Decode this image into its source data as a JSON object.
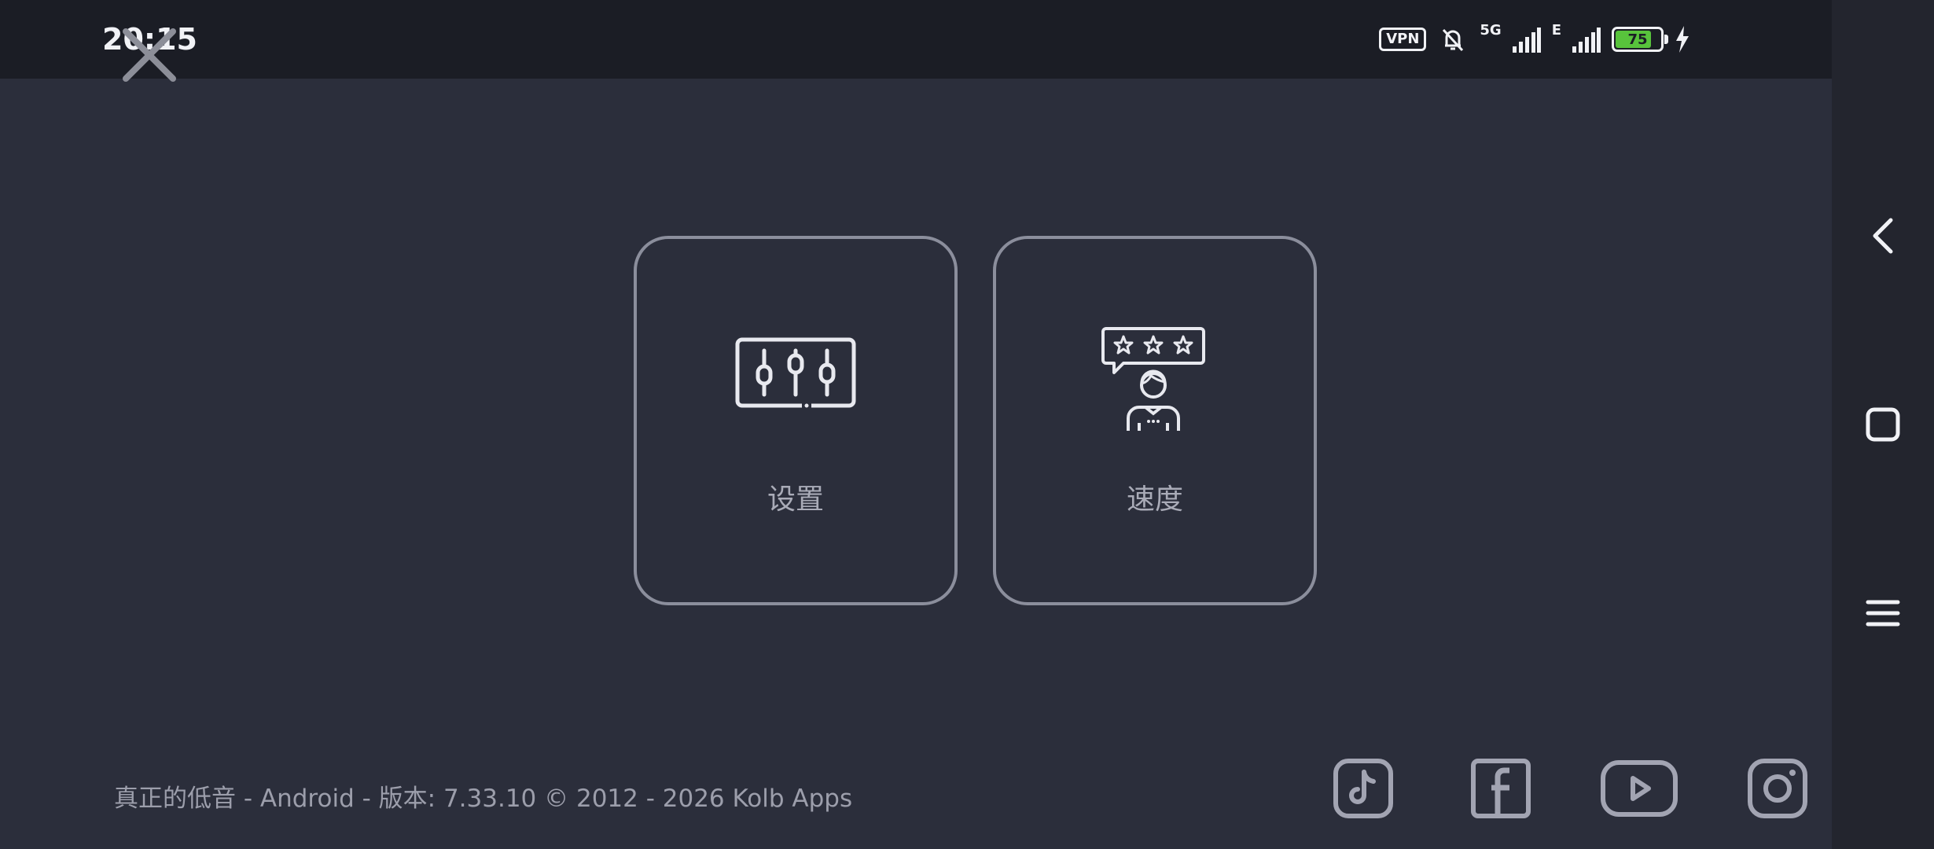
{
  "status_bar": {
    "time": "20:15",
    "vpn_label": "VPN",
    "network_primary": "5G",
    "network_secondary": "E",
    "battery_level": "75"
  },
  "tiles": [
    {
      "label": "设置",
      "icon": "sliders-icon"
    },
    {
      "label": "速度",
      "icon": "rating-person-icon"
    }
  ],
  "footer": {
    "text": "真正的低音 - Android - 版本: 7.33.10 © 2012 - 2026 Kolb Apps"
  },
  "social_icons": [
    "tiktok-icon",
    "facebook-icon",
    "youtube-icon",
    "instagram-icon"
  ],
  "colors": {
    "background": "#2b2e3b",
    "status_bar": "#1b1d25",
    "card_border": "#8b8e9c",
    "battery": "#58c33c"
  }
}
